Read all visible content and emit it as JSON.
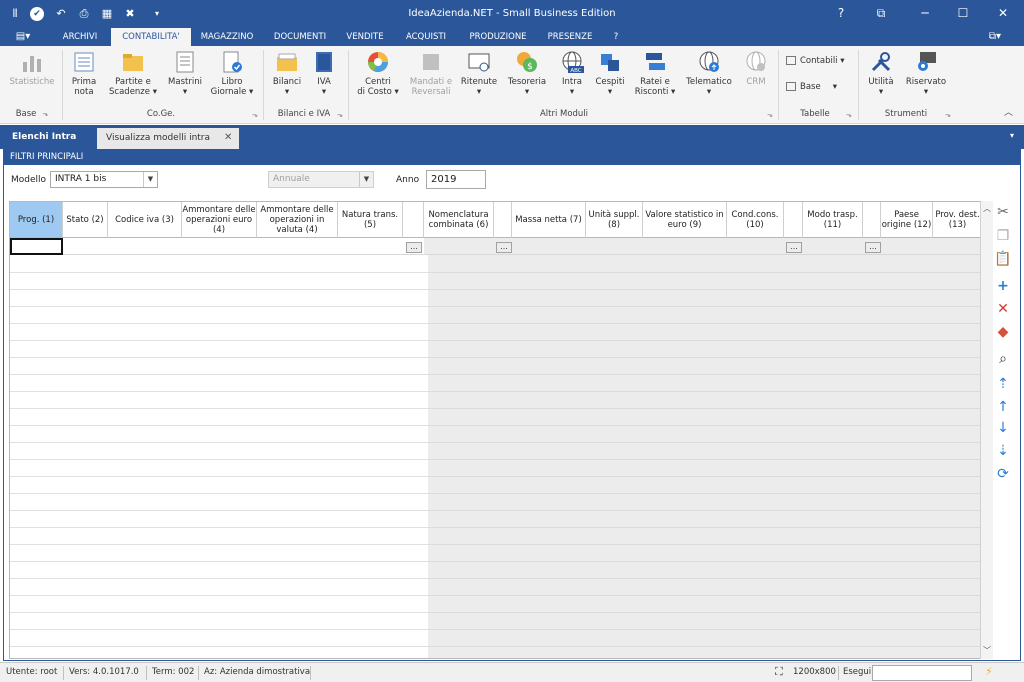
{
  "titlebar": {
    "title": "IdeaAzienda.NET - Small Business Edition",
    "help": "?"
  },
  "menu": [
    "ARCHIVI",
    "CONTABILITA'",
    "MAGAZZINO",
    "DOCUMENTI",
    "VENDITE",
    "ACQUISTI",
    "PRODUZIONE",
    "PRESENZE",
    "?"
  ],
  "ribbon": {
    "statistiche": "Statistiche",
    "prima_nota_1": "Prima",
    "prima_nota_2": "nota",
    "partite_1": "Partite e",
    "partite_2": "Scadenze ▾",
    "mastrini_1": "Mastrini",
    "mastrini_2": "▾",
    "libro_1": "Libro",
    "libro_2": "Giornale ▾",
    "bilanci_1": "Bilanci",
    "bilanci_2": "▾",
    "iva_1": "IVA",
    "iva_2": "▾",
    "centri_1": "Centri",
    "centri_2": "di Costo ▾",
    "mandati_1": "Mandati e",
    "mandati_2": "Reversali",
    "ritenute_1": "Ritenute",
    "ritenute_2": "▾",
    "tesoreria_1": "Tesoreria",
    "tesoreria_2": "▾",
    "intra_1": "Intra",
    "intra_2": "▾",
    "cespiti_1": "Cespiti",
    "cespiti_2": "▾",
    "ratei_1": "Ratei e",
    "ratei_2": "Risconti ▾",
    "telematico_1": "Telematico",
    "telematico_2": "▾",
    "crm": "CRM",
    "contabili": "Contabili ▾",
    "base": "Base",
    "utilita_1": "Utilità",
    "utilita_2": "▾",
    "riservato_1": "Riservato",
    "riservato_2": "▾",
    "intra_icon_text": "ABC",
    "groups": {
      "base": "Base",
      "coge": "Co.Ge.",
      "bilanci_iva": "Bilanci e IVA",
      "altri": "Altri Moduli",
      "tabelle": "Tabelle",
      "strumenti": "Strumenti"
    }
  },
  "tabs": {
    "elenchi": "Elenchi Intra",
    "visualizza": "Visualizza modelli intra"
  },
  "filters": {
    "header": "FILTRI PRINCIPALI",
    "modello_label": "Modello",
    "modello_value": "INTRA 1 bis",
    "periodo_value": "Annuale",
    "anno_label": "Anno",
    "anno_value": "2019"
  },
  "grid": {
    "columns": [
      "Prog. (1)",
      "Stato (2)",
      "Codice iva (3)",
      "Ammontare delle operazioni euro (4)",
      "Ammontare delle operazioni in valuta (4)",
      "Natura trans. (5)",
      "",
      "Nomenclatura combinata (6)",
      "",
      "Massa netta (7)",
      "Unità suppl. (8)",
      "Valore statistico in euro (9)",
      "Cond.cons. (10)",
      "",
      "Modo trasp. (11)",
      "",
      "Paese origine (12)",
      "Prov. dest.(13)"
    ],
    "ellipsis": "..."
  },
  "status": {
    "utente": "Utente: root",
    "versione": "Vers: 4.0.1017.0",
    "terminale": "Term: 002",
    "azienda": "Az: Azienda dimostrativa",
    "risoluzione": "1200x800",
    "esegui": "Esegui"
  }
}
